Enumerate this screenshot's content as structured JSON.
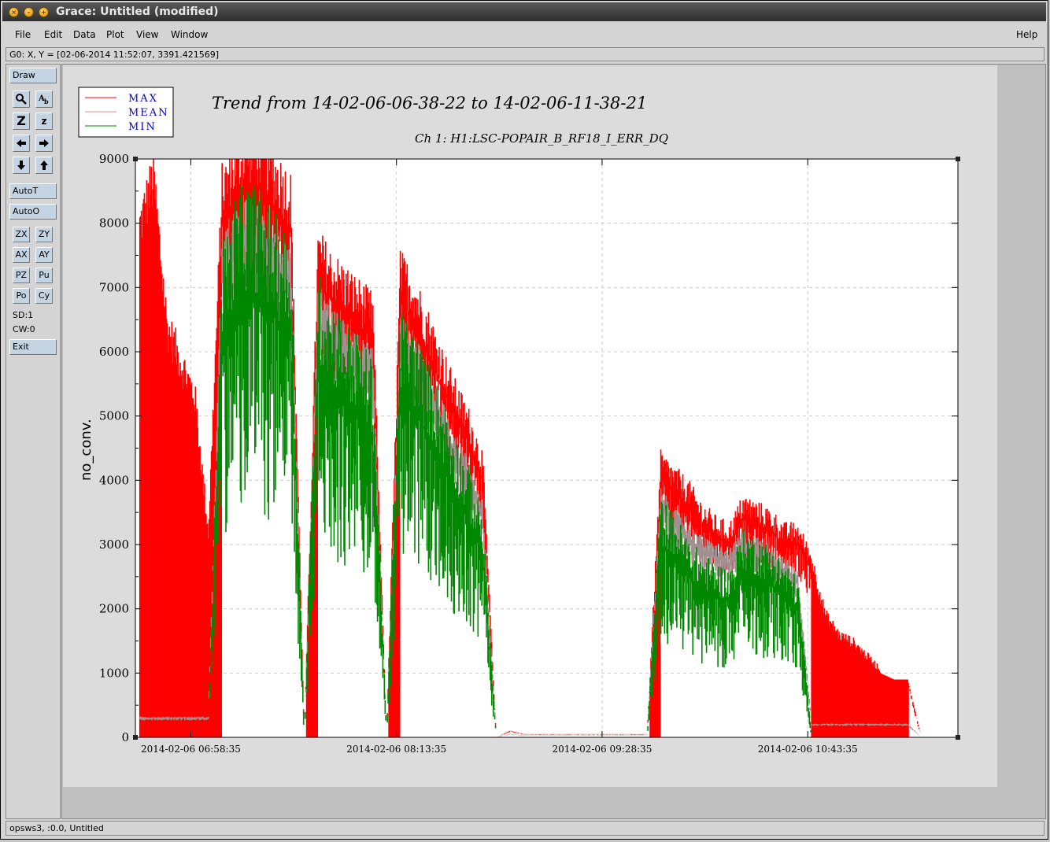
{
  "window": {
    "title": "Grace: Untitled (modified)"
  },
  "menu": {
    "items": [
      "File",
      "Edit",
      "Data",
      "Plot",
      "View",
      "Window"
    ],
    "help": "Help"
  },
  "locator": "G0: X, Y = [02-06-2014 11:52:07, 3391.421569]",
  "toolbar": {
    "draw": "Draw",
    "autot": "AutoT",
    "autoo": "AutoO",
    "pairs": [
      [
        "ZX",
        "ZY"
      ],
      [
        "AX",
        "AY"
      ],
      [
        "PZ",
        "Pu"
      ],
      [
        "Po",
        "Cy"
      ]
    ],
    "sd": "SD:1",
    "cw": "CW:0",
    "exit": "Exit"
  },
  "status": "opsws3, :0.0, Untitled",
  "colors": {
    "max": "#ff0000",
    "mean": "#a09090",
    "min": "#008800"
  },
  "chart_data": {
    "type": "line",
    "title": "Trend from 14-02-06-06-38-22 to 14-02-06-11-38-21",
    "subtitle": "Ch 1: H1:LSC-POPAIR_B_RF18_I_ERR_DQ",
    "ylabel": "no_conv.",
    "xlabel": "",
    "ylim": [
      0,
      9000
    ],
    "xlim": [
      "2014-02-06 06:38:22",
      "2014-02-06 11:38:21"
    ],
    "yticks": [
      0,
      1000,
      2000,
      3000,
      4000,
      5000,
      6000,
      7000,
      8000,
      9000
    ],
    "xticks": [
      "2014-02-06 06:58:35",
      "2014-02-06 08:13:35",
      "2014-02-06 09:28:35",
      "2014-02-06 10:43:35"
    ],
    "grid": true,
    "legend": "top-left",
    "x": [
      "06:40",
      "06:45",
      "06:50",
      "06:55",
      "07:00",
      "07:05",
      "07:10",
      "07:15",
      "07:20",
      "07:25",
      "07:30",
      "07:35",
      "07:40",
      "07:45",
      "07:50",
      "07:55",
      "08:00",
      "08:05",
      "08:10",
      "08:15",
      "08:20",
      "08:25",
      "08:30",
      "08:35",
      "08:40",
      "08:45",
      "08:50",
      "08:55",
      "09:00",
      "09:05",
      "09:10",
      "09:15",
      "09:20",
      "09:25",
      "09:30",
      "09:35",
      "09:40",
      "09:45",
      "09:50",
      "09:55",
      "10:00",
      "10:05",
      "10:10",
      "10:15",
      "10:20",
      "10:25",
      "10:30",
      "10:35",
      "10:40",
      "10:45",
      "10:50",
      "10:55",
      "11:00",
      "11:05",
      "11:10",
      "11:15",
      "11:20",
      "11:25",
      "11:30",
      "11:35"
    ],
    "series": [
      {
        "name": "MAX",
        "values": [
          7500,
          8200,
          6000,
          5500,
          5000,
          3000,
          8000,
          8400,
          8600,
          8500,
          8200,
          7900,
          0,
          7100,
          6800,
          6600,
          6400,
          6200,
          0,
          6800,
          6500,
          6000,
          5500,
          5000,
          4600,
          4000,
          0,
          100,
          50,
          50,
          50,
          50,
          50,
          50,
          50,
          50,
          50,
          50,
          4000,
          3800,
          3600,
          3300,
          3100,
          3000,
          3400,
          3300,
          3200,
          3000,
          3000,
          2600,
          1800,
          1500,
          1400,
          1200,
          1000,
          900,
          900,
          0,
          0,
          0
        ]
      },
      {
        "name": "MEAN",
        "values": [
          300,
          300,
          300,
          300,
          300,
          300,
          7200,
          7600,
          7800,
          7600,
          7300,
          7000,
          0,
          6500,
          6200,
          6000,
          5800,
          5600,
          0,
          6100,
          5800,
          5400,
          4900,
          4400,
          4000,
          3400,
          0,
          50,
          30,
          30,
          30,
          30,
          30,
          30,
          30,
          30,
          30,
          30,
          3600,
          3300,
          3100,
          2900,
          2800,
          2700,
          3000,
          2900,
          2800,
          2600,
          2400,
          200,
          200,
          200,
          200,
          200,
          200,
          200,
          200,
          0,
          0,
          0
        ]
      },
      {
        "name": "MIN",
        "values": [
          0,
          0,
          0,
          0,
          0,
          0,
          6200,
          6800,
          7000,
          6800,
          6500,
          6200,
          0,
          5800,
          5500,
          5200,
          5000,
          4700,
          0,
          5400,
          5100,
          4700,
          4300,
          3800,
          3400,
          2800,
          0,
          0,
          0,
          0,
          0,
          0,
          0,
          0,
          0,
          0,
          0,
          0,
          3000,
          2800,
          2500,
          2300,
          2200,
          2100,
          2600,
          2500,
          2400,
          2200,
          2000,
          0,
          0,
          0,
          0,
          0,
          0,
          0,
          0,
          0,
          0,
          0
        ]
      }
    ]
  }
}
